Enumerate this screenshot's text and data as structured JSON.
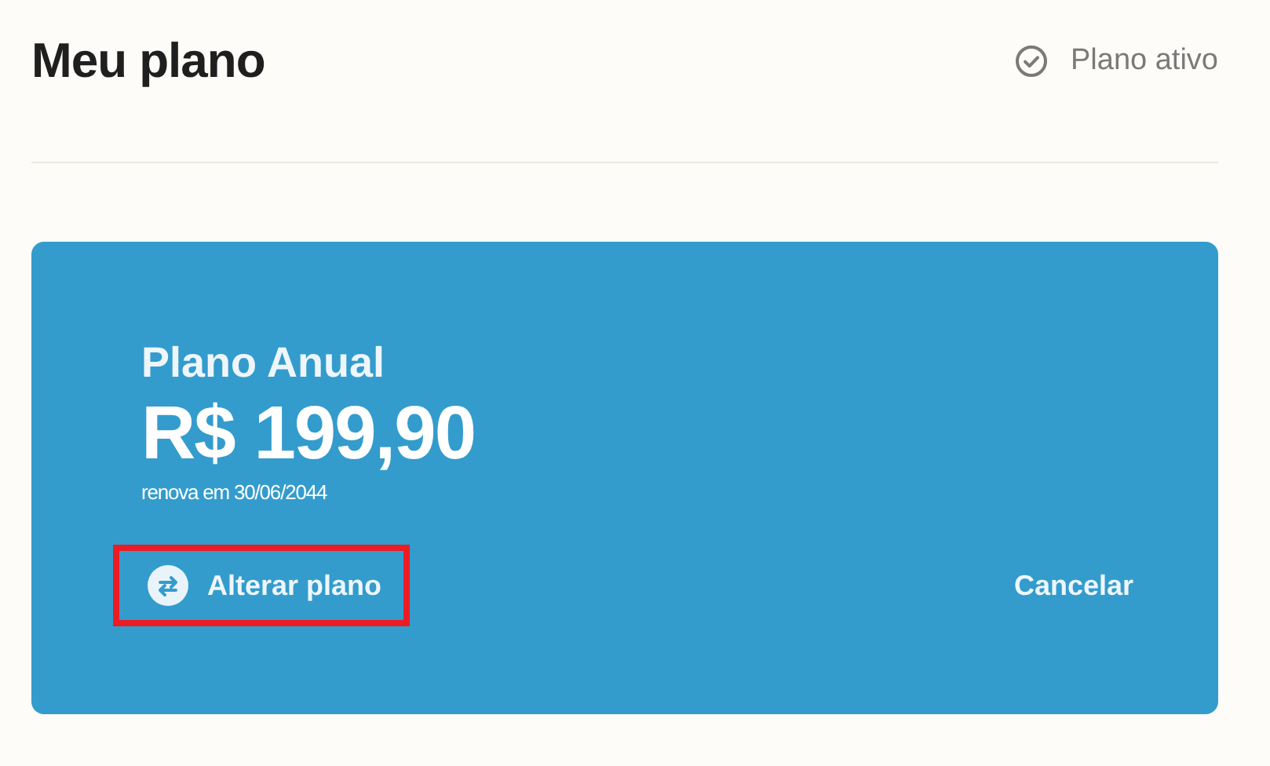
{
  "header": {
    "title": "Meu plano",
    "status": "Plano ativo"
  },
  "plan": {
    "name": "Plano Anual",
    "price": "R$ 199,90",
    "renewal": "renova em 30/06/2044"
  },
  "actions": [
    {
      "kind": "change",
      "label": "Alterar plano",
      "highlighted": true
    },
    {
      "kind": "cancel",
      "label": "Cancelar",
      "highlighted": false
    }
  ]
}
